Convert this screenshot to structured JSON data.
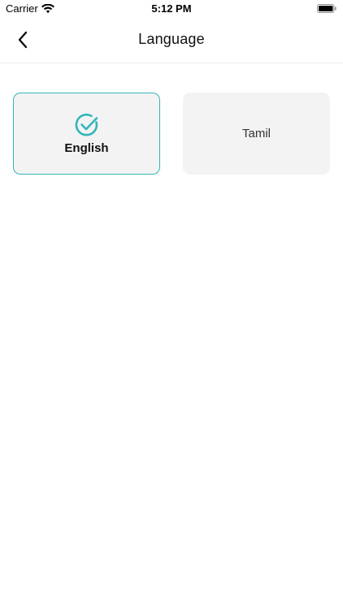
{
  "status_bar": {
    "carrier": "Carrier",
    "time": "5:12 PM",
    "icons": [
      "wifi-icon",
      "battery-icon"
    ]
  },
  "nav": {
    "title": "Language",
    "back_icon": "chevron-left-icon"
  },
  "languages": [
    {
      "label": "English",
      "selected": true,
      "icon": "check-circle-icon"
    },
    {
      "label": "Tamil",
      "selected": false
    }
  ],
  "colors": {
    "accent": "#33b5b9",
    "card_background": "#f3f3f3",
    "divider": "#ececec"
  }
}
